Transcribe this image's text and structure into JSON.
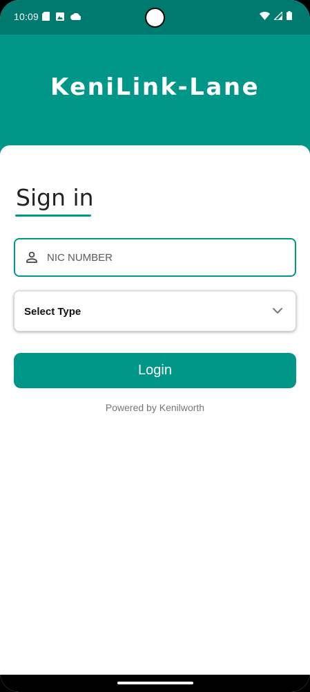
{
  "status_bar": {
    "time": "10:09",
    "left_icons": [
      "sd-card-icon",
      "photo-icon",
      "cloud-icon"
    ],
    "right_icons": [
      "wifi-icon",
      "signal-icon",
      "battery-icon"
    ]
  },
  "header": {
    "title": "KeniLink-Lane"
  },
  "signin": {
    "title": "Sign in",
    "nic_placeholder": "NIC NUMBER",
    "select_type_label": "Select Type",
    "login_label": "Login",
    "powered_by": "Powered by Kenilworth"
  },
  "colors": {
    "primary": "#009688",
    "status_bar": "#007a6e",
    "muted_text": "#757575"
  }
}
